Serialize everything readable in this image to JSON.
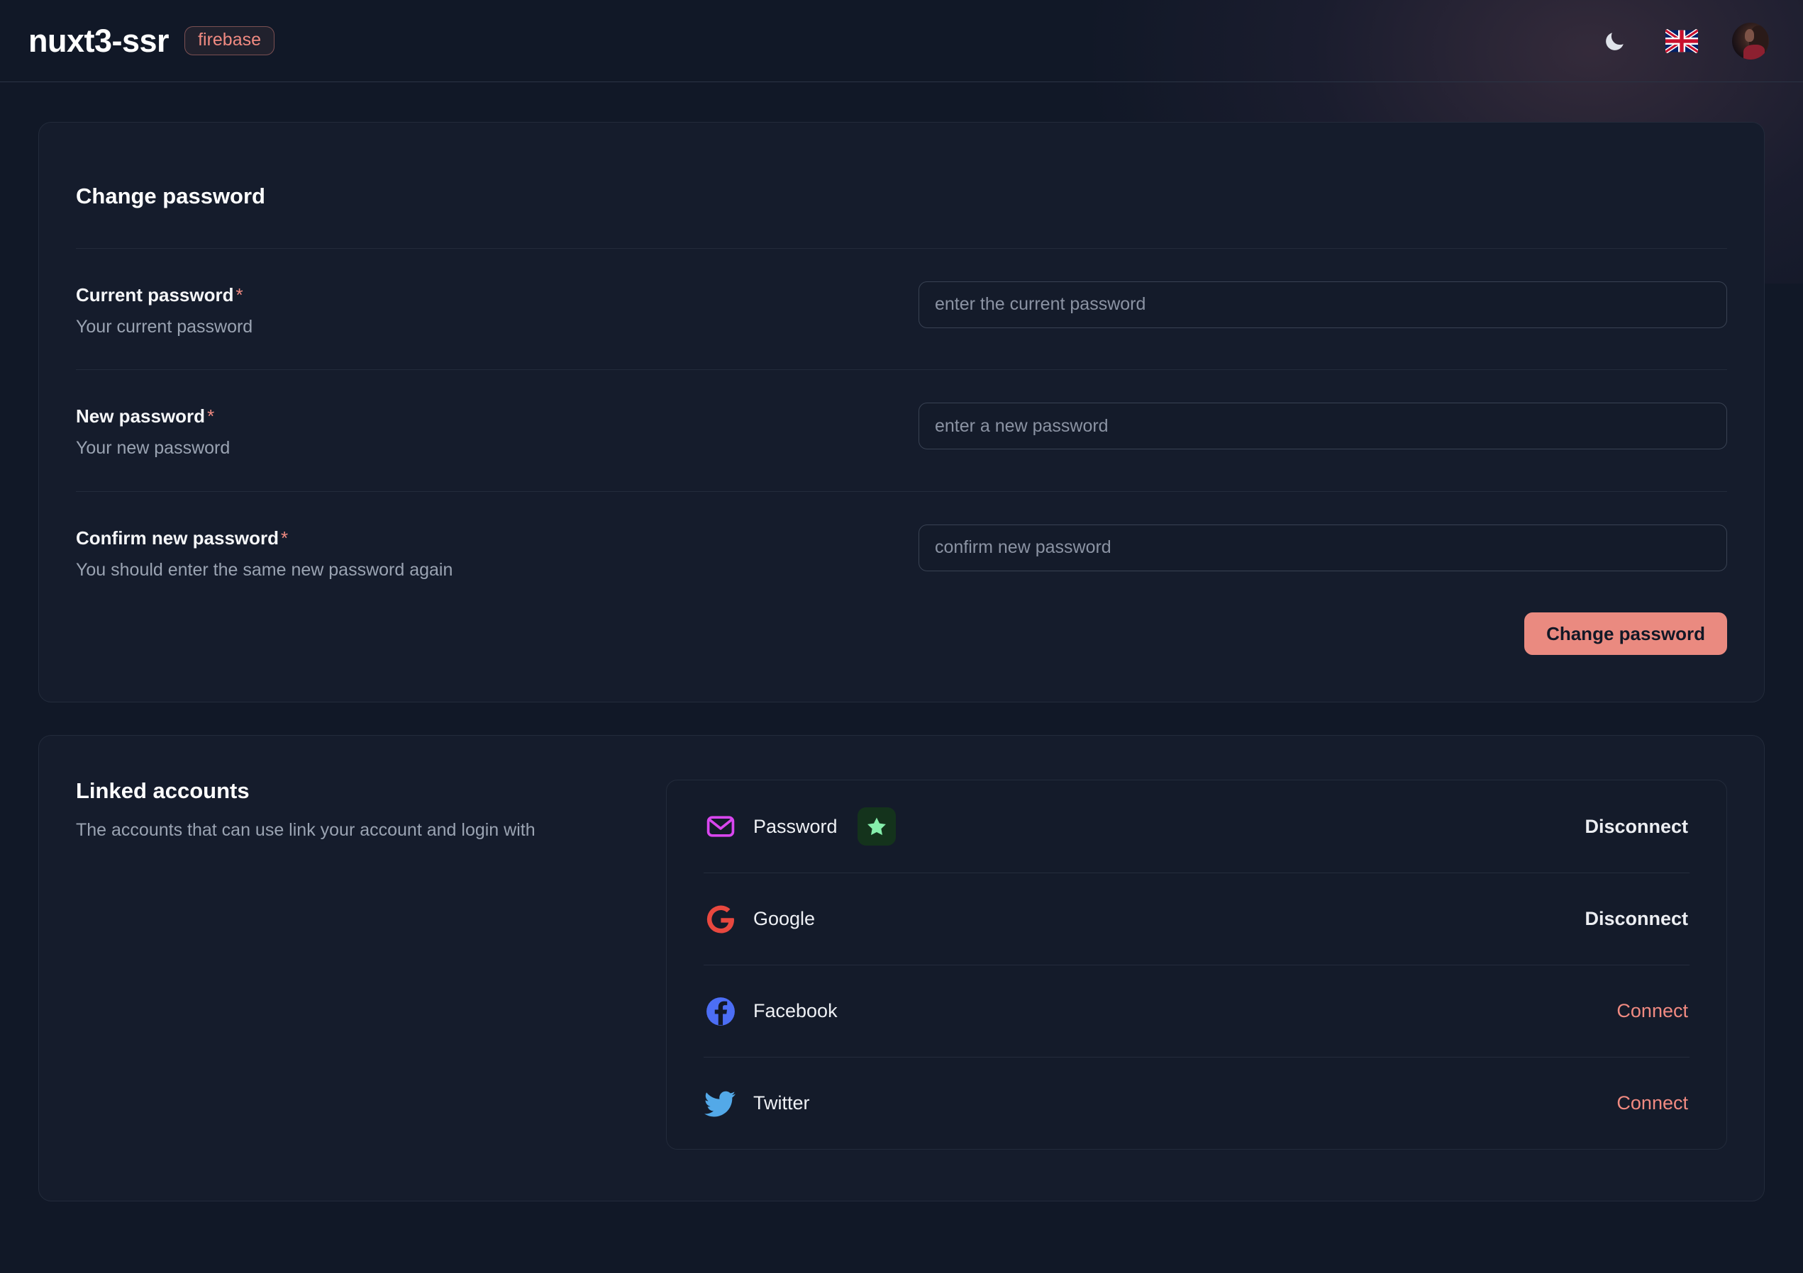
{
  "header": {
    "brand_title": "nuxt3-ssr",
    "brand_badge": "firebase",
    "theme_toggle_icon": "moon-icon",
    "language_icon": "uk-flag-icon",
    "avatar_icon": "user-avatar"
  },
  "colors": {
    "background": "#111827",
    "panel": "#151c2c",
    "border": "#232b3b",
    "accent": "#ea8a80",
    "accent_text": "#f08a81",
    "text": "#f3f4f6",
    "text_dim": "#9aa3b2",
    "badge_green": "#86efac",
    "badge_green_bg": "#14331c",
    "mail_icon": "#d946ef",
    "google_icon": "#e8483f",
    "facebook_icon": "#4c6ef5",
    "twitter_icon": "#53a9e8"
  },
  "change_password": {
    "title": "Change password",
    "fields": [
      {
        "label": "Current password",
        "required_marker": "*",
        "help": "Your current password",
        "placeholder": "enter the current password",
        "value": ""
      },
      {
        "label": "New password",
        "required_marker": "*",
        "help": "Your new password",
        "placeholder": "enter a new password",
        "value": ""
      },
      {
        "label": "Confirm new password",
        "required_marker": "*",
        "help": "You should enter the same new password again",
        "placeholder": "confirm new password",
        "value": ""
      }
    ],
    "submit_label": "Change password"
  },
  "linked_accounts": {
    "title": "Linked accounts",
    "description": "The accounts that can use link your account and login with",
    "providers": [
      {
        "name": "Password",
        "icon": "mail-icon",
        "primary_badge": "star-icon",
        "action_label": "Disconnect",
        "action_state": "connected"
      },
      {
        "name": "Google",
        "icon": "google-icon",
        "primary_badge": "",
        "action_label": "Disconnect",
        "action_state": "connected"
      },
      {
        "name": "Facebook",
        "icon": "facebook-icon",
        "primary_badge": "",
        "action_label": "Connect",
        "action_state": "disconnected"
      },
      {
        "name": "Twitter",
        "icon": "twitter-icon",
        "primary_badge": "",
        "action_label": "Connect",
        "action_state": "disconnected"
      }
    ]
  }
}
